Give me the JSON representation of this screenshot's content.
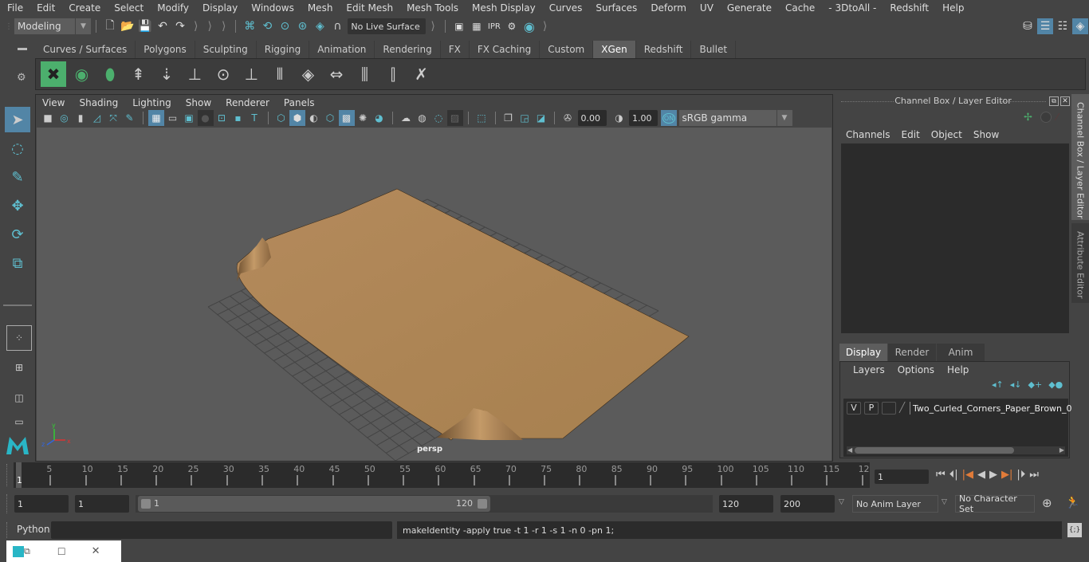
{
  "menubar": {
    "items": [
      "File",
      "Edit",
      "Create",
      "Select",
      "Modify",
      "Display",
      "Windows",
      "Mesh",
      "Edit Mesh",
      "Mesh Tools",
      "Mesh Display",
      "Curves",
      "Surfaces",
      "Deform",
      "UV",
      "Generate",
      "Cache",
      "- 3DtoAll -",
      "Redshift",
      "Help"
    ]
  },
  "statusline": {
    "workspace_mode": "Modeling",
    "live_surface": "No Live Surface"
  },
  "shelf": {
    "tabs": [
      "Curves / Surfaces",
      "Polygons",
      "Sculpting",
      "Rigging",
      "Animation",
      "Rendering",
      "FX",
      "FX Caching",
      "Custom",
      "XGen",
      "Redshift",
      "Bullet"
    ],
    "active_tab": "XGen",
    "icons": [
      "xgen-create-description-icon",
      "xgen-toggle-preview-icon",
      "xgen-hide-preview-icon",
      "xgen-add-guides-icon",
      "xgen-place-guides-icon",
      "xgen-add-guide-icon",
      "xgen-show-guides-icon",
      "xgen-lock-guides-icon",
      "xgen-guide-split-icon",
      "xgen-groom-patch-icon",
      "xgen-guide-length-icon",
      "xgen-select-guides-icon",
      "xgen-guide-region-icon",
      "xgen-delete-guides-icon"
    ]
  },
  "viewport": {
    "menu": [
      "View",
      "Shading",
      "Lighting",
      "Show",
      "Renderer",
      "Panels"
    ],
    "exposure": "0.00",
    "gamma": "1.00",
    "color_mgmt_badge": "ON",
    "color_space": "sRGB gamma",
    "camera_label": "persp"
  },
  "channel_box": {
    "title": "Channel Box / Layer Editor",
    "menu": [
      "Channels",
      "Edit",
      "Object",
      "Show"
    ]
  },
  "layer_editor": {
    "tabs": [
      "Display",
      "Render",
      "Anim"
    ],
    "active_tab": "Display",
    "menu": [
      "Layers",
      "Options",
      "Help"
    ],
    "layers": [
      {
        "visible": "V",
        "playback": "P",
        "name": "Two_Curled_Corners_Paper_Brown_0"
      }
    ]
  },
  "side_tabs": [
    "Channel Box / Layer Editor",
    "Attribute Editor"
  ],
  "timeline": {
    "ticks": [
      "5",
      "10",
      "15",
      "20",
      "25",
      "30",
      "35",
      "40",
      "45",
      "50",
      "55",
      "60",
      "65",
      "70",
      "75",
      "80",
      "85",
      "90",
      "95",
      "100",
      "105",
      "110",
      "115",
      "12"
    ],
    "current_frame_marker": "1",
    "current_frame": "1"
  },
  "range": {
    "start_time": "1",
    "playback_start": "1",
    "range_slider_start": "1",
    "range_slider_end": "120",
    "playback_end": "120",
    "end_time": "200",
    "anim_layer": "No Anim Layer",
    "character_set": "No Character Set"
  },
  "command_line": {
    "language": "Python",
    "input": "",
    "result": "makeIdentity -apply true -t 1 -r 1 -s 1 -n 0 -pn 1;"
  },
  "colors": {
    "accent_blue": "#5285a6",
    "teal_icon": "#5fbfd0",
    "xgen_green": "#4caf6d",
    "paper_brown": "#b88c5c",
    "viewport_bg": "#5b5b5b",
    "keyframe_orange": "#e07b39"
  }
}
